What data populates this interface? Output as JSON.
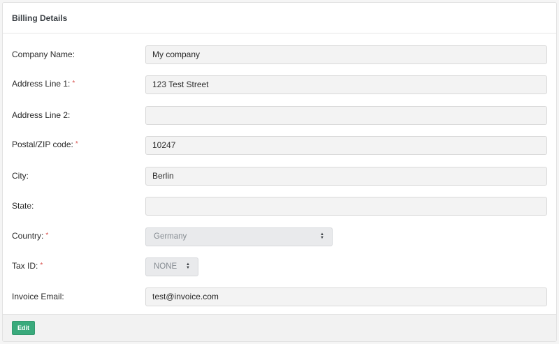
{
  "panel": {
    "title": "Billing Details"
  },
  "fields": {
    "company_name": {
      "label": "Company Name:",
      "value": "My company"
    },
    "address_line_1": {
      "label": "Address Line 1:",
      "required_mark": "*",
      "value": "123 Test Street"
    },
    "address_line_2": {
      "label": "Address Line 2:",
      "value": ""
    },
    "postal_code": {
      "label": "Postal/ZIP code:",
      "required_mark": "*",
      "value": "10247"
    },
    "city": {
      "label": "City:",
      "value": "Berlin"
    },
    "state": {
      "label": "State:",
      "value": ""
    },
    "country": {
      "label": "Country:",
      "required_mark": "*",
      "selected": "Germany"
    },
    "tax_id": {
      "label": "Tax ID:",
      "required_mark": "*",
      "selected": "NONE"
    },
    "invoice_email": {
      "label": "Invoice Email:",
      "value": "test@invoice.com"
    }
  },
  "footer": {
    "edit_label": "Edit"
  },
  "icons": {
    "select_up": "▲",
    "select_down": "▼"
  },
  "colors": {
    "edit_button": "#3aaa7c",
    "required": "#d9534f"
  }
}
